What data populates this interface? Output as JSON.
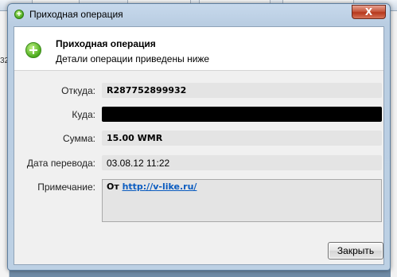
{
  "background": {
    "left_text": "32",
    "tabs": [
      "...",
      "..."
    ]
  },
  "window": {
    "title": "Приходная операция",
    "close_label": "X"
  },
  "header": {
    "title": "Приходная операция",
    "subtitle": "Детали операции приведены ниже"
  },
  "fields": {
    "from_label": "Откуда:",
    "from_value": "R287752899932",
    "to_label": "Куда:",
    "amount_label": "Сумма:",
    "amount_value": "15.00 WMR",
    "date_label": "Дата перевода:",
    "date_value": "03.08.12 11:22",
    "note_label": "Примечание:",
    "note_prefix": "От ",
    "note_link": "http://v-like.ru/"
  },
  "buttons": {
    "close": "Закрыть"
  },
  "colors": {
    "accent_green": "#46a61c",
    "link": "#0b5cc0",
    "arrow": "#e0b800"
  }
}
